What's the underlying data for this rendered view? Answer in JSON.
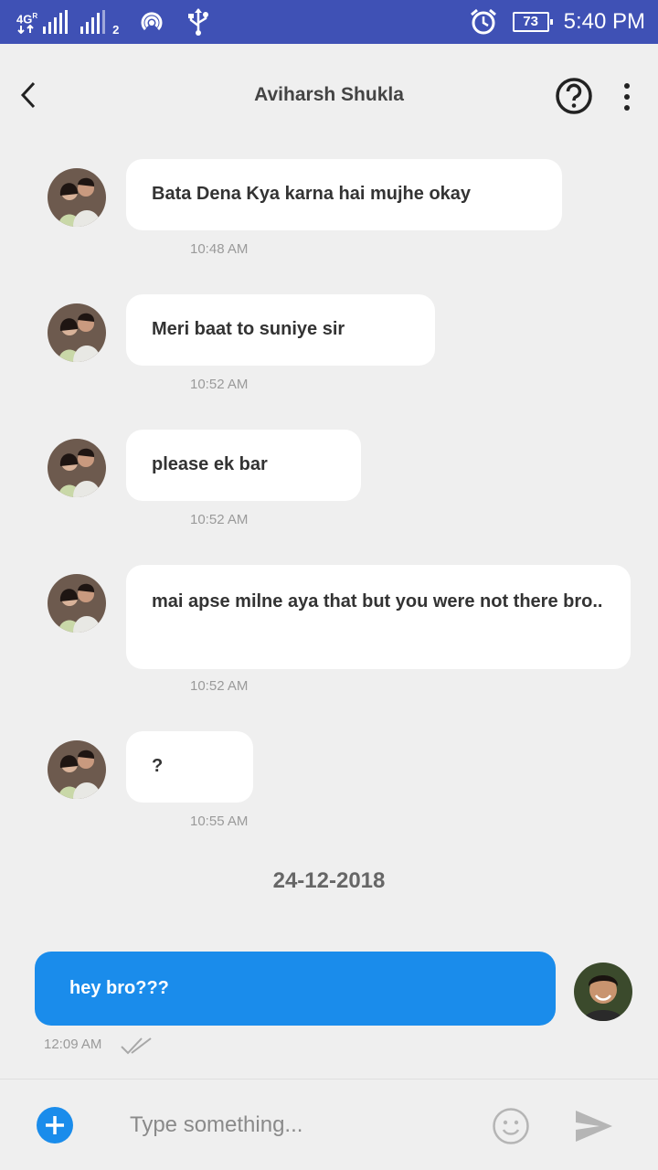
{
  "status_bar": {
    "network": "4G",
    "roaming": "R",
    "sim2": "2",
    "battery": "73",
    "time": "5:40 PM",
    "icons": [
      "signal-icon",
      "hotspot-icon",
      "usb-icon",
      "alarm-icon",
      "battery-icon"
    ]
  },
  "header": {
    "title": "Aviharsh Shukla",
    "icons": [
      "back-icon",
      "help-icon",
      "more-icon"
    ]
  },
  "messages_in": [
    {
      "text": "Bata Dena Kya karna hai mujhe okay",
      "time": "10:48 AM"
    },
    {
      "text": "Meri baat to suniye sir",
      "time": "10:52 AM"
    },
    {
      "text": "please ek bar",
      "time": "10:52 AM"
    },
    {
      "text": "mai apse milne aya that but you were not there bro..",
      "time": "10:52 AM"
    },
    {
      "text": "?",
      "time": "10:55 AM"
    }
  ],
  "date_separator": "24-12-2018",
  "message_out": {
    "text": "hey bro???",
    "time": "12:09 AM",
    "status_icon": "double-check-icon"
  },
  "compose": {
    "placeholder": "Type something...",
    "icons": [
      "plus-icon",
      "emoji-icon",
      "send-icon"
    ]
  },
  "colors": {
    "status_bar": "#3f51b5",
    "accent": "#1a8ceb",
    "background": "#efefef"
  }
}
